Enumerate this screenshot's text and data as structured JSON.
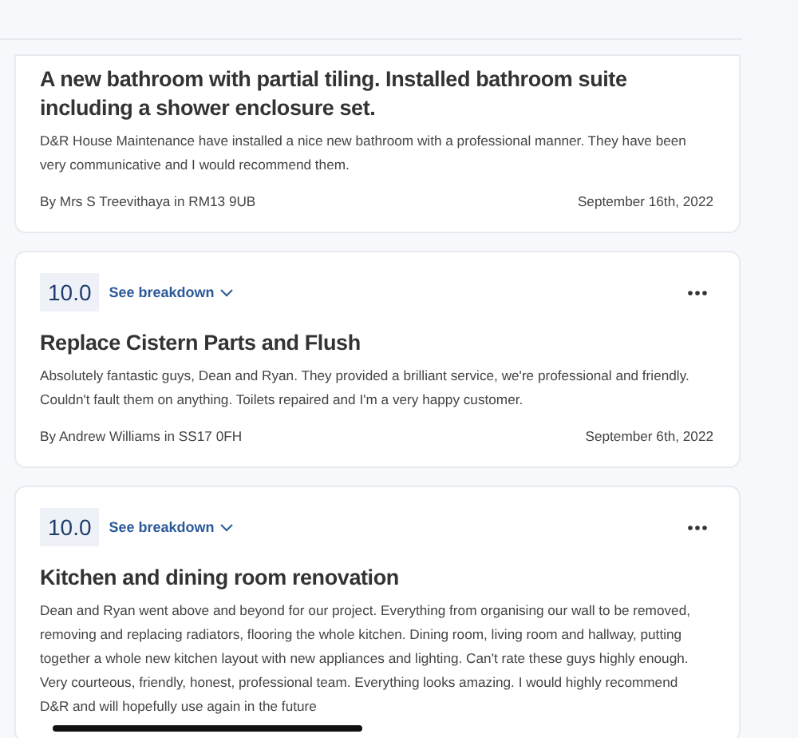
{
  "reviews": [
    {
      "title": "A new bathroom with partial tiling.  Installed bathroom suite including a shower enclosure set.",
      "body": "D&R House Maintenance have installed a nice new bathroom with a professional manner.   They have been very communicative and I would recommend them.",
      "author": "By Mrs S Treevithaya in RM13 9UB",
      "date": "September 16th, 2022"
    },
    {
      "score": "10.0",
      "breakdown_label": "See breakdown",
      "title": "Replace Cistern Parts and Flush",
      "body": "Absolutely fantastic guys, Dean and Ryan.  They provided a brilliant service, we're professional and friendly.  Couldn't fault them on anything.  Toilets repaired and I'm a very happy customer.",
      "author": "By Andrew Williams in SS17 0FH",
      "date": "September 6th, 2022"
    },
    {
      "score": "10.0",
      "breakdown_label": "See breakdown",
      "title": "Kitchen and dining room renovation",
      "body": "Dean and Ryan went above and beyond for our project.  Everything from organising our wall to be removed, removing and replacing radiators, flooring the whole kitchen.  Dining room, living room and hallway, putting together a whole new kitchen layout with new appliances and lighting.  Can't rate these guys highly enough.  Very courteous, friendly, honest, professional team.  Everything looks amazing.  I would highly recommend D&R and will hopefully use again in the future"
    }
  ]
}
